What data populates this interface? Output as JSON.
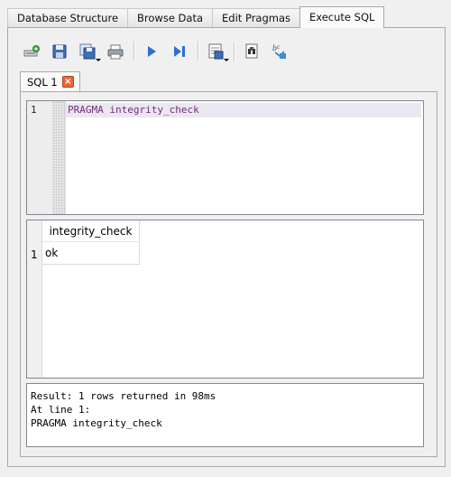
{
  "main_tabs": [
    {
      "label": "Database Structure",
      "active": false
    },
    {
      "label": "Browse Data",
      "active": false
    },
    {
      "label": "Edit Pragmas",
      "active": false
    },
    {
      "label": "Execute SQL",
      "active": true
    }
  ],
  "toolbar": {
    "buttons": [
      "open-tab-icon",
      "open-sql-file-icon",
      "save-sql-file-icon",
      "print-icon",
      "execute-all-icon",
      "execute-line-icon",
      "save-results-icon",
      "find-icon",
      "find-replace-icon"
    ]
  },
  "editor": {
    "tab_label": "SQL 1",
    "close_glyph": "×",
    "line_number": "1",
    "code": "PRAGMA integrity_check"
  },
  "results": {
    "columns": [
      "integrity_check"
    ],
    "rows": [
      {
        "row_number": "1",
        "values": [
          "ok"
        ]
      }
    ]
  },
  "message": {
    "lines": [
      "Result: 1 rows returned in 98ms",
      "At line 1:",
      "PRAGMA integrity_check"
    ]
  },
  "colors": {
    "keyword": "#7a2b7a",
    "close_button": "#e26a3b",
    "current_line": "#e9e7ef"
  }
}
